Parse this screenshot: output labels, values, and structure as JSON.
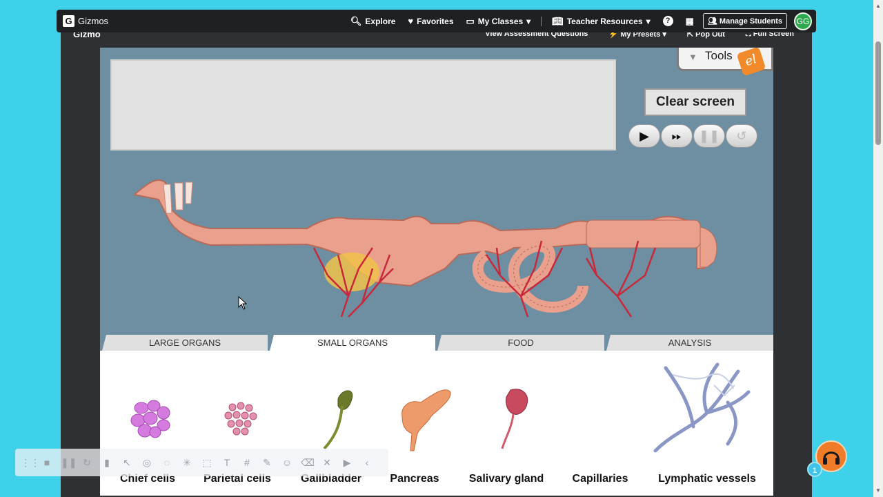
{
  "nav": {
    "brand": "Gizmos",
    "items": [
      {
        "label": "Explore",
        "icon": "search-icon"
      },
      {
        "label": "Favorites",
        "icon": "heart-icon"
      },
      {
        "label": "My Classes",
        "icon": "classes-icon"
      },
      {
        "label": "Teacher Resources",
        "icon": "book-icon"
      }
    ],
    "manage_students": "Manage Students",
    "avatar_initials": "GG"
  },
  "subbar": {
    "title": "Gizmo",
    "links": [
      "View Assessment Questions",
      "My Presets",
      "Pop Out",
      "Full Screen"
    ]
  },
  "sim": {
    "tools_label": "Tools",
    "el_badge": "el",
    "clear_screen": "Clear screen"
  },
  "tabs": [
    "LARGE ORGANS",
    "SMALL ORGANS",
    "FOOD",
    "ANALYSIS"
  ],
  "active_tab": "SMALL ORGANS",
  "organs": [
    "Chief cells",
    "Parietal cells",
    "Gallbladder",
    "Pancreas",
    "Salivary gland",
    "Capillaries",
    "Lymphatic vessels"
  ],
  "help": {
    "badge_count": "1"
  },
  "colors": {
    "sim_bg": "#6e8ea2",
    "page_bg": "#3fd0ea",
    "accent": "#f07c2a"
  }
}
